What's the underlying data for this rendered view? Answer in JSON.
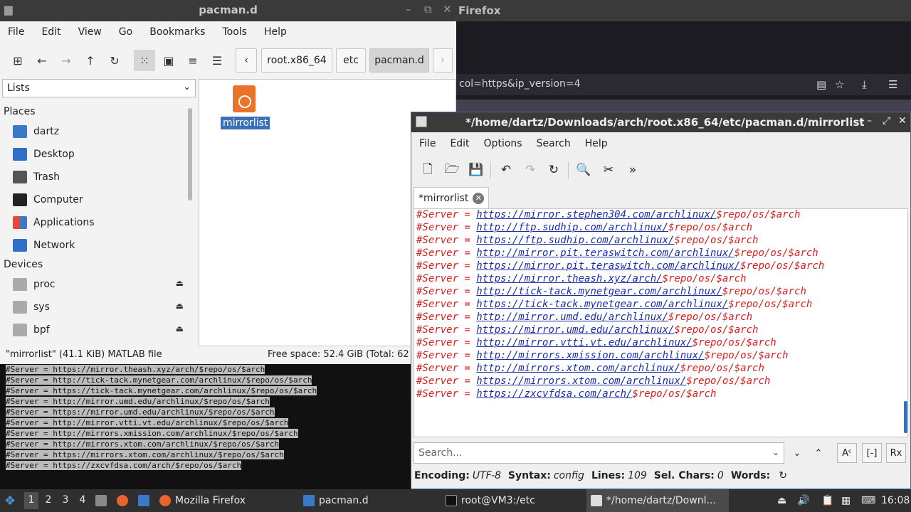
{
  "firefox": {
    "title": "Firefox",
    "url_fragment": "col=https&ip_version=4"
  },
  "filemanager": {
    "title": "pacman.d",
    "menu": [
      "File",
      "Edit",
      "View",
      "Go",
      "Bookmarks",
      "Tools",
      "Help"
    ],
    "breadcrumbs": [
      "root.x86_64",
      "etc",
      "pacman.d"
    ],
    "side_combo": "Lists",
    "places_header": "Places",
    "places": [
      "dartz",
      "Desktop",
      "Trash",
      "Computer",
      "Applications",
      "Network"
    ],
    "devices_header": "Devices",
    "devices": [
      "proc",
      "sys",
      "bpf"
    ],
    "file_name": "mirrorlist",
    "status_left": "\"mirrorlist\" (41.1 KiB) MATLAB file",
    "status_right": "Free space: 52.4 GiB (Total: 62"
  },
  "terminal": {
    "lines": [
      "#Server = https://mirror.theash.xyz/arch/$repo/os/$arch",
      "#Server = http://tick-tack.mynetgear.com/archlinux/$repo/os/$arch",
      "#Server = https://tick-tack.mynetgear.com/archlinux/$repo/os/$arch",
      "#Server = http://mirror.umd.edu/archlinux/$repo/os/$arch",
      "#Server = https://mirror.umd.edu/archlinux/$repo/os/$arch",
      "#Server = http://mirror.vtti.vt.edu/archlinux/$repo/os/$arch",
      "#Server = http://mirrors.xmission.com/archlinux/$repo/os/$arch",
      "#Server = http://mirrors.xtom.com/archlinux/$repo/os/$arch",
      "#Server = https://mirrors.xtom.com/archlinux/$repo/os/$arch",
      "#Server = https://zxcvfdsa.com/arch/$repo/os/$arch"
    ]
  },
  "editor": {
    "title": "*/home/dartz/Downloads/arch/root.x86_64/etc/pacman.d/mirrorlist",
    "menu": [
      "File",
      "Edit",
      "Options",
      "Search",
      "Help"
    ],
    "tab_label": "*mirrorlist",
    "code_lines": [
      {
        "prefix": "#Server = ",
        "url": "https://mirror.stephen304.com/archlinux/",
        "suffix": "$repo/os/$arch"
      },
      {
        "prefix": "#Server = ",
        "url": "http://ftp.sudhip.com/archlinux/",
        "suffix": "$repo/os/$arch"
      },
      {
        "prefix": "#Server = ",
        "url": "https://ftp.sudhip.com/archlinux/",
        "suffix": "$repo/os/$arch"
      },
      {
        "prefix": "#Server = ",
        "url": "http://mirror.pit.teraswitch.com/archlinux/",
        "suffix": "$repo/os/$arch"
      },
      {
        "prefix": "#Server = ",
        "url": "https://mirror.pit.teraswitch.com/archlinux/",
        "suffix": "$repo/os/$arch"
      },
      {
        "prefix": "#Server = ",
        "url": "https://mirror.theash.xyz/arch/",
        "suffix": "$repo/os/$arch"
      },
      {
        "prefix": "#Server = ",
        "url": "http://tick-tack.mynetgear.com/archlinux/",
        "suffix": "$repo/os/$arch"
      },
      {
        "prefix": "#Server = ",
        "url": "https://tick-tack.mynetgear.com/archlinux/",
        "suffix": "$repo/os/$arch"
      },
      {
        "prefix": "#Server = ",
        "url": "http://mirror.umd.edu/archlinux/",
        "suffix": "$repo/os/$arch"
      },
      {
        "prefix": "#Server = ",
        "url": "https://mirror.umd.edu/archlinux/",
        "suffix": "$repo/os/$arch"
      },
      {
        "prefix": "#Server = ",
        "url": "http://mirror.vtti.vt.edu/archlinux/",
        "suffix": "$repo/os/$arch"
      },
      {
        "prefix": "#Server = ",
        "url": "http://mirrors.xmission.com/archlinux/",
        "suffix": "$repo/os/$arch"
      },
      {
        "prefix": "#Server = ",
        "url": "http://mirrors.xtom.com/archlinux/",
        "suffix": "$repo/os/$arch"
      },
      {
        "prefix": "#Server = ",
        "url": "https://mirrors.xtom.com/archlinux/",
        "suffix": "$repo/os/$arch"
      },
      {
        "prefix": "#Server = ",
        "url": "https://zxcvfdsa.com/arch/",
        "suffix": "$repo/os/$arch"
      }
    ],
    "search_placeholder": "Search...",
    "status": {
      "encoding_label": "Encoding:",
      "encoding": "UTF-8",
      "syntax_label": "Syntax:",
      "syntax": "config",
      "lines_label": "Lines:",
      "lines": "109",
      "sel_label": "Sel. Chars:",
      "sel": "0",
      "words_label": "Words:"
    }
  },
  "taskbar": {
    "workspaces": [
      "1",
      "2",
      "3",
      "4"
    ],
    "tasks": [
      "Mozilla Firefox",
      "pacman.d",
      "root@VM3:/etc",
      "*/home/dartz/Downl..."
    ],
    "clock": "16:08"
  },
  "colors": {
    "accent": "#3b6fb6",
    "code_comment": "#d91e1e",
    "code_url": "#1d2fa8"
  }
}
